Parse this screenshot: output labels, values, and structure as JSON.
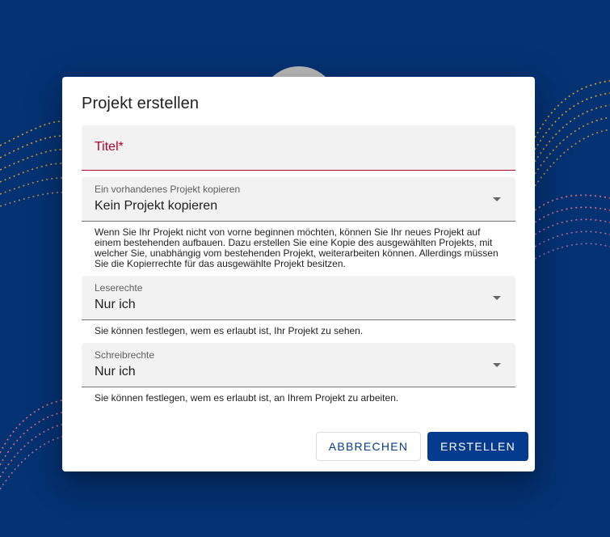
{
  "dialog": {
    "title": "Projekt erstellen",
    "title_field": {
      "label": "Titel*"
    },
    "copy_field": {
      "label": "Ein vorhandenes Projekt kopieren",
      "value": "Kein Projekt kopieren",
      "hint": "Wenn Sie Ihr Projekt nicht von vorne beginnen möchten, können Sie Ihr neues Projekt auf einem bestehenden aufbauen. Dazu erstellen Sie eine Kopie des ausgewählten Projekts, mit welcher Sie, unabhängig vom bestehenden Projekt, weiterarbeiten können. Allerdings müssen Sie die Kopierrechte für das ausgewählte Projekt besitzen."
    },
    "read_field": {
      "label": "Leserechte",
      "value": "Nur ich",
      "hint": "Sie können festlegen, wem es erlaubt ist, Ihr Projekt zu sehen."
    },
    "write_field": {
      "label": "Schreibrechte",
      "value": "Nur ich",
      "hint": "Sie können festlegen, wem es erlaubt ist, an Ihrem Projekt zu arbeiten."
    },
    "cancel_label": "Abbrechen",
    "create_label": "Erstellen"
  },
  "colors": {
    "background": "#053273",
    "accent": "#053b8f",
    "error": "#b0002a"
  }
}
